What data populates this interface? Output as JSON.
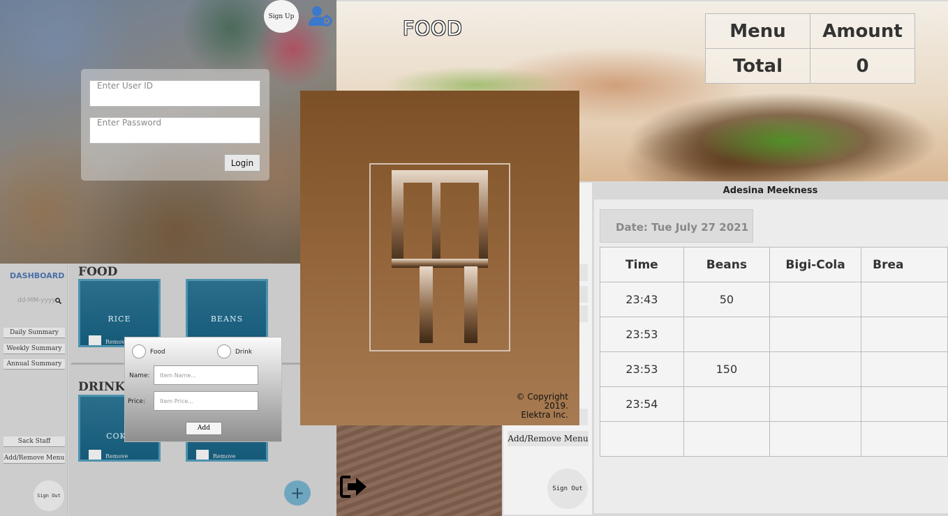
{
  "login": {
    "signup_label": "Sign Up",
    "user_id_placeholder": "Enter User ID",
    "password_placeholder": "Enter Password",
    "login_label": "Login"
  },
  "header": {
    "title": "FOOD",
    "totals": {
      "menu_label": "Menu",
      "amount_label": "Amount",
      "total_label": "Total",
      "total_value": "0"
    }
  },
  "splash": {
    "copyright_line1": "© Copyright 2019.",
    "copyright_line2": "Elektra Inc."
  },
  "dashboard": {
    "title": "DASHBOARD",
    "date_placeholder": "dd-MM-yyyy",
    "nav": [
      "Daily Summary",
      "Weekly Summary",
      "Annual Summary",
      "Sack Staff",
      "Add/Remove Menu"
    ],
    "signout_label": "Sign Out",
    "food_heading": "FOOD",
    "drink_heading": "DRINK",
    "food_items": [
      "RICE",
      "BEANS"
    ],
    "drink_items": [
      "COKE",
      ""
    ],
    "remove_label": "Remove",
    "add_fab": "+"
  },
  "add_dialog": {
    "food_option": "Food",
    "drink_option": "Drink",
    "name_label": "Name:",
    "name_placeholder": "Item Name...",
    "price_label": "Price:",
    "price_placeholder": "Item Price...",
    "add_label": "Add"
  },
  "mid_panel": {
    "add_remove_label": "Add/Remove Menu",
    "signout_label": "Sign Out"
  },
  "summary": {
    "user_name": "Adesina Meekness",
    "date_text": "Date: Tue July 27 2021",
    "columns": [
      "Time",
      "Beans",
      "Bigi-Cola",
      "Brea"
    ],
    "rows": [
      [
        "23:43",
        "50",
        "",
        ""
      ],
      [
        "23:53",
        "",
        "",
        ""
      ],
      [
        "23:53",
        "150",
        "",
        ""
      ],
      [
        "23:54",
        "",
        "",
        ""
      ],
      [
        "",
        "",
        "",
        ""
      ]
    ]
  },
  "colors": {
    "dashboard_accent": "#4a6fa7",
    "menu_card": "#1b6585",
    "splash_brown": "#8a5c32"
  },
  "icons": [
    "user-gear-icon",
    "search-icon",
    "fork-logo-icon",
    "signout-arrow-icon",
    "plus-icon"
  ]
}
